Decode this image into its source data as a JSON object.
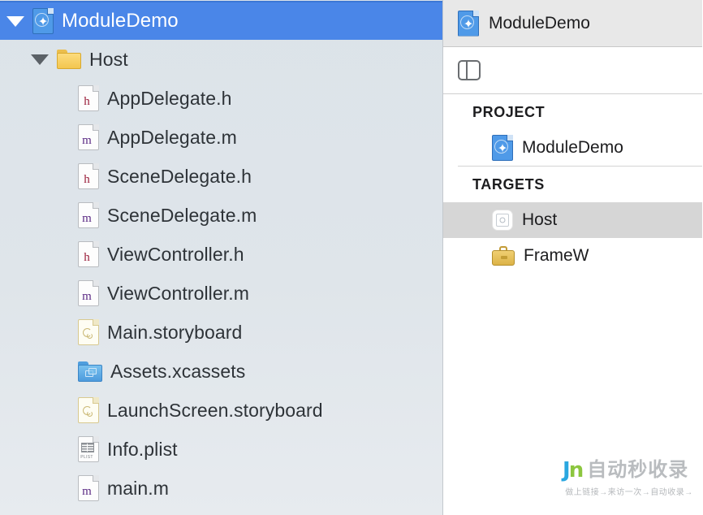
{
  "navigator": {
    "rows": [
      {
        "label": "ModuleDemo",
        "icon": "xcodeproj-icon",
        "indent": 0,
        "selected": true,
        "disclosure": "down"
      },
      {
        "label": "Host",
        "icon": "folder-icon",
        "indent": 1,
        "selected": false,
        "disclosure": "down"
      },
      {
        "label": "AppDelegate.h",
        "icon": "header-file-icon",
        "letter": "h",
        "indent": 2,
        "selected": false
      },
      {
        "label": "AppDelegate.m",
        "icon": "implementation-file-icon",
        "letter": "m",
        "indent": 2,
        "selected": false
      },
      {
        "label": "SceneDelegate.h",
        "icon": "header-file-icon",
        "letter": "h",
        "indent": 2,
        "selected": false
      },
      {
        "label": "SceneDelegate.m",
        "icon": "implementation-file-icon",
        "letter": "m",
        "indent": 2,
        "selected": false
      },
      {
        "label": "ViewController.h",
        "icon": "header-file-icon",
        "letter": "h",
        "indent": 2,
        "selected": false
      },
      {
        "label": "ViewController.m",
        "icon": "implementation-file-icon",
        "letter": "m",
        "indent": 2,
        "selected": false
      },
      {
        "label": "Main.storyboard",
        "icon": "storyboard-icon",
        "indent": 2,
        "selected": false
      },
      {
        "label": "Assets.xcassets",
        "icon": "xcassets-icon",
        "indent": 2,
        "selected": false
      },
      {
        "label": "LaunchScreen.storyboard",
        "icon": "storyboard-icon",
        "indent": 2,
        "selected": false
      },
      {
        "label": "Info.plist",
        "icon": "plist-icon",
        "tag": "PLIST",
        "indent": 2,
        "selected": false
      },
      {
        "label": "main.m",
        "icon": "implementation-file-icon",
        "letter": "m",
        "indent": 2,
        "selected": false
      }
    ]
  },
  "editor": {
    "breadcrumb": {
      "label": "ModuleDemo",
      "icon": "xcodeproj-icon"
    },
    "toolbar": {
      "sidebar_toggle_icon": "sidebar-toggle-icon"
    },
    "sections": [
      {
        "heading": "PROJECT",
        "rows": [
          {
            "label": "ModuleDemo",
            "icon": "xcodeproj-icon",
            "selected": false
          }
        ]
      },
      {
        "heading": "TARGETS",
        "rows": [
          {
            "label": "Host",
            "icon": "app-target-icon",
            "selected": true
          },
          {
            "label": "FrameW",
            "icon": "framework-target-icon",
            "selected": false
          }
        ]
      }
    ]
  },
  "watermark": {
    "mark_j": "J",
    "mark_n": "n",
    "title": "自动秒收录",
    "subtitle": "做上链接→来访一次→自动收录→"
  },
  "colors": {
    "selection_blue": "#4a86e8",
    "navigator_background": "#dce3e9",
    "editor_background": "#ffffff",
    "target_selected": "#d6d6d6",
    "header_letter": "#9a1f3c",
    "impl_letter": "#5b2a84"
  }
}
